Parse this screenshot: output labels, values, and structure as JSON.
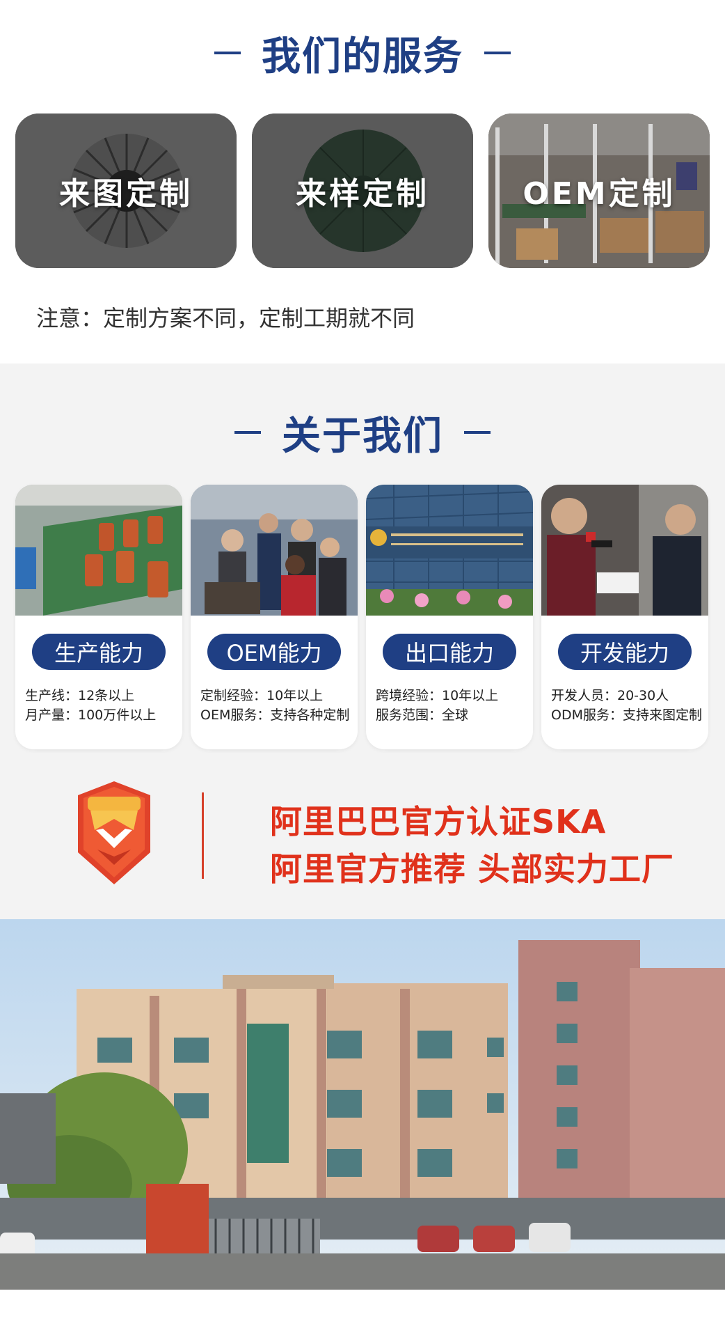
{
  "services": {
    "title": "我们的服务",
    "cards": [
      {
        "label": "来图定制"
      },
      {
        "label": "来样定制"
      },
      {
        "label": "OEM定制"
      }
    ],
    "note": "注意：定制方案不同，定制工期就不同"
  },
  "about": {
    "title": "关于我们",
    "cards": [
      {
        "title": "生产能力",
        "line1": "生产线：12条以上",
        "line2": "月产量：100万件以上"
      },
      {
        "title": "OEM能力",
        "line1": "定制经验：10年以上",
        "line2": "OEM服务：支持各种定制"
      },
      {
        "title": "出口能力",
        "line1": "跨境经验：10年以上",
        "line2": "服务范围：全球"
      },
      {
        "title": "开发能力",
        "line1": "开发人员：20-30人",
        "line2": "ODM服务：支持来图定制"
      }
    ],
    "certification_line1": "阿里巴巴官方认证SKA",
    "certification_line2": "阿里官方推荐 头部实力工厂"
  },
  "colors": {
    "brand_blue": "#1f3f84",
    "accent_red": "#e0311b",
    "panel_gray": "#f3f3f3"
  },
  "icons": [
    "crown-shield-badge-icon"
  ]
}
